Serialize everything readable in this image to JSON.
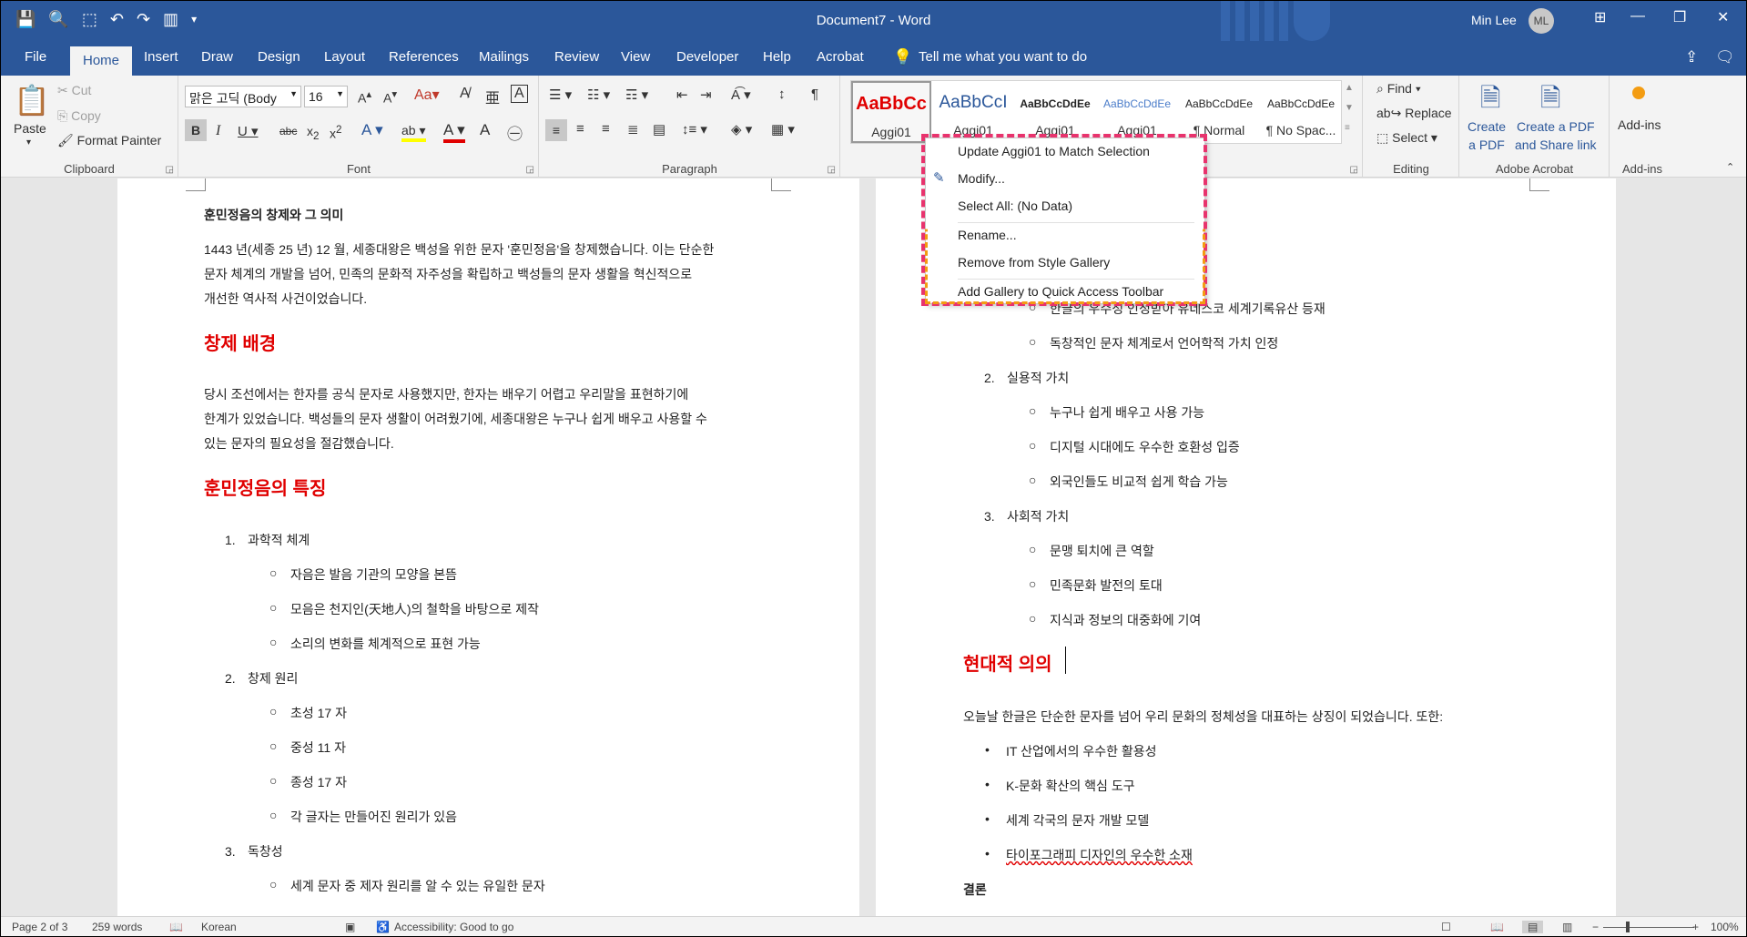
{
  "window": {
    "title": "Document7  -  Word",
    "user_name": "Min Lee",
    "user_initials": "ML"
  },
  "tabs": [
    "File",
    "Home",
    "Insert",
    "Draw",
    "Design",
    "Layout",
    "References",
    "Mailings",
    "Review",
    "View",
    "Developer",
    "Help",
    "Acrobat"
  ],
  "tell_me": "Tell me what you want to do",
  "clipboard": {
    "paste": "Paste",
    "cut": "Cut",
    "copy": "Copy",
    "format_painter": "Format Painter",
    "label": "Clipboard"
  },
  "font": {
    "family": "맑은 고딕 (Body",
    "size": "16",
    "label": "Font"
  },
  "paragraph": {
    "label": "Paragraph"
  },
  "styles": {
    "items": [
      {
        "sample": "AaBbCc",
        "label": "Aggi01"
      },
      {
        "sample": "AaBbCcI",
        "label": "Aggi01"
      },
      {
        "sample": "AaBbCcDdEe",
        "label": "Aggi01"
      },
      {
        "sample": "AaBbCcDdEe",
        "label": "Aggi01"
      },
      {
        "sample": "AaBbCcDdEe",
        "label": "¶ Normal"
      },
      {
        "sample": "AaBbCcDdEe",
        "label": "¶ No Spac..."
      }
    ],
    "label": "Styles"
  },
  "editing": {
    "find": "Find",
    "replace": "Replace",
    "select": "Select",
    "label": "Editing"
  },
  "acrobat": {
    "create_pdf": "Create\na PDF",
    "create_share": "Create a PDF\nand Share link",
    "label": "Adobe Acrobat"
  },
  "addins": {
    "button": "Add-ins",
    "label": "Add-ins"
  },
  "context_menu": {
    "items": [
      "Update Aggi01 to Match Selection",
      "Modify...",
      "Select All: (No Data)",
      "Rename...",
      "Remove from Style Gallery",
      "Add Gallery to Quick Access Toolbar"
    ]
  },
  "page_left": {
    "title": "훈민정음의 창제와 그 의미",
    "intro": [
      "1443 년(세종 25 년) 12 월, 세종대왕은 백성을 위한 문자 '훈민정음'을 창제했습니다. 이는 단순한",
      "문자 체계의 개발을 넘어, 민족의 문화적 자주성을 확립하고 백성들의 문자 생활을 혁신적으로",
      "개선한 역사적 사건이었습니다."
    ],
    "h1": "창제 배경",
    "bg": [
      "당시 조선에서는 한자를 공식 문자로 사용했지만, 한자는 배우기 어렵고 우리말을 표현하기에",
      "한계가 있었습니다. 백성들의 문자 생활이 어려웠기에, 세종대왕은 누구나 쉽게 배우고 사용할 수",
      "있는 문자의 필요성을 절감했습니다."
    ],
    "h2": "훈민정음의 특징",
    "list": [
      {
        "num": "1.",
        "text": "과학적 체계",
        "subs": [
          "자음은 발음 기관의 모양을 본뜸",
          "모음은 천지인(天地人)의 철학을 바탕으로 제작",
          "소리의 변화를 체계적으로 표현 가능"
        ]
      },
      {
        "num": "2.",
        "text": "창제 원리",
        "subs": [
          "초성 17 자",
          "중성 11 자",
          "종성 17 자",
          "각 글자는 만들어진 원리가 있음"
        ]
      },
      {
        "num": "3.",
        "text": "독창성",
        "subs": [
          "세계 문자 중 제자 원리를 알 수 있는 유일한 문자"
        ]
      }
    ]
  },
  "page_right": {
    "subs_a": [
      "한글의 우수성 인정받아 유네스코 세계기록유산 등재",
      "독창적인 문자 체계로서 언어학적 가치 인정"
    ],
    "item2": {
      "num": "2.",
      "text": "실용적 가치",
      "subs": [
        "누구나 쉽게 배우고 사용 가능",
        "디지털 시대에도 우수한 호환성 입증",
        "외국인들도 비교적 쉽게 학습 가능"
      ]
    },
    "item3": {
      "num": "3.",
      "text": "사회적 가치",
      "subs": [
        "문맹 퇴치에 큰 역할",
        "민족문화 발전의 토대",
        "지식과 정보의 대중화에 기여"
      ]
    },
    "heading": "현대적 의의",
    "para": "오늘날 한글은 단순한 문자를 넘어 우리 문화의 정체성을 대표하는 상징이 되었습니다. 또한:",
    "bullets": [
      "IT 산업에서의 우수한 활용성",
      "K-문화 확산의 핵심 도구",
      "세계 각국의 문자 개발 모델",
      "타이포그래피 디자인의 우수한 소재"
    ],
    "conclusion": "결론"
  },
  "status": {
    "page": "Page 2 of 3",
    "words": "259 words",
    "language": "Korean",
    "accessibility": "Accessibility: Good to go",
    "zoom": "100%"
  }
}
